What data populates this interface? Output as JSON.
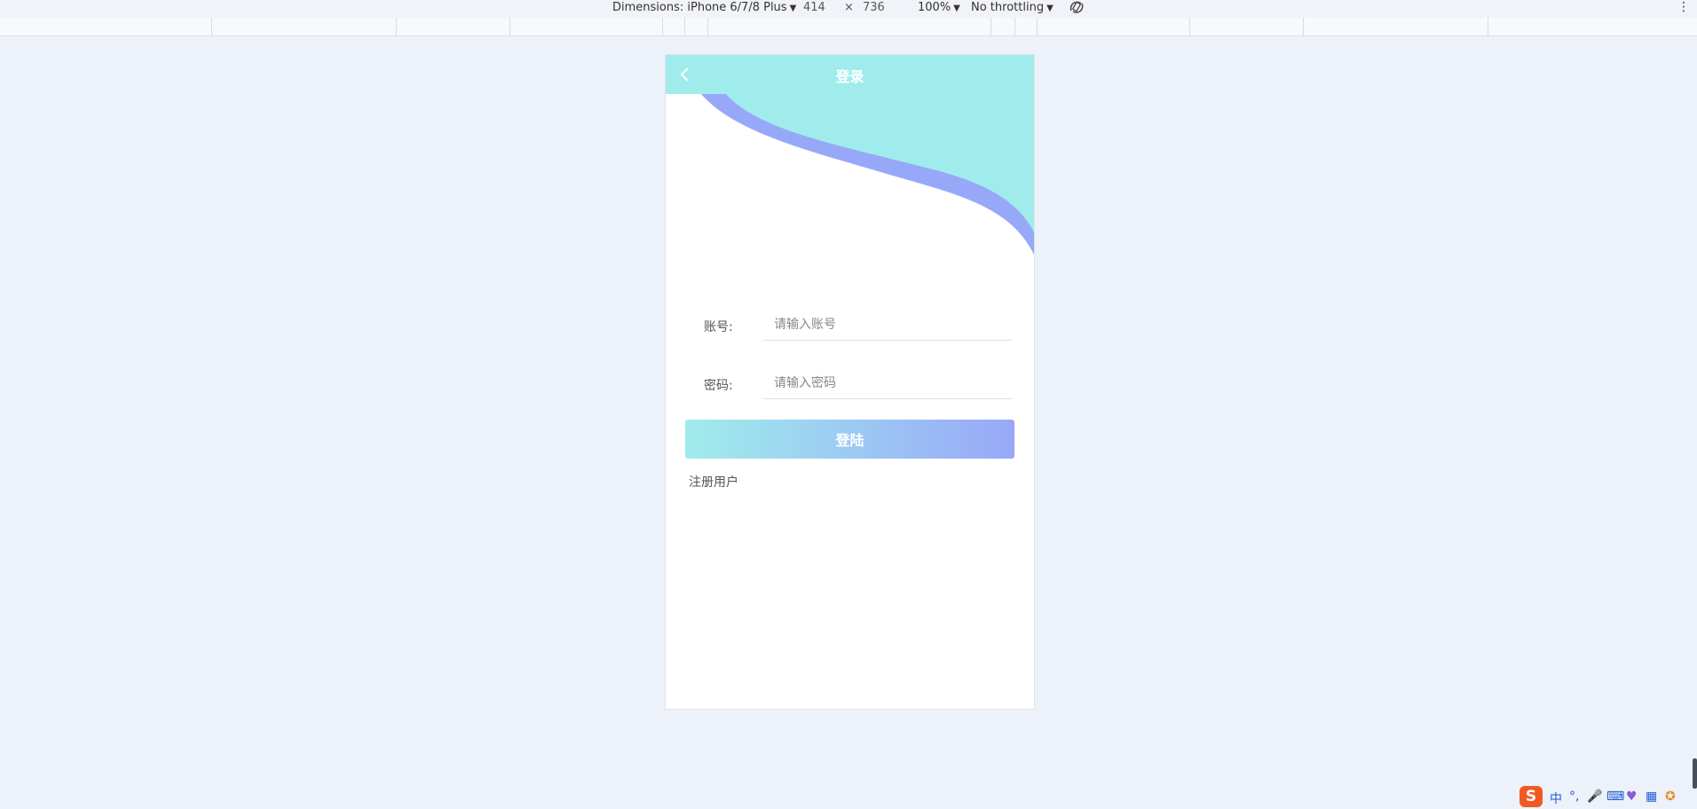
{
  "devtools": {
    "dimensions_label": "Dimensions: iPhone 6/7/8 Plus",
    "width": "414",
    "times": "×",
    "height": "736",
    "zoom": "100%",
    "throttling": "No throttling"
  },
  "page": {
    "title": "登录",
    "account_label": "账号:",
    "account_placeholder": "请输入账号",
    "password_label": "密码:",
    "password_placeholder": "请输入密码",
    "login_button": "登陆",
    "register_link": "注册用户"
  },
  "ime": {
    "lang": "中",
    "punct": "°,"
  },
  "colors": {
    "header": "#a0ecec",
    "wave_accent": "#98a8f8",
    "page_bg": "#edf1f9"
  }
}
